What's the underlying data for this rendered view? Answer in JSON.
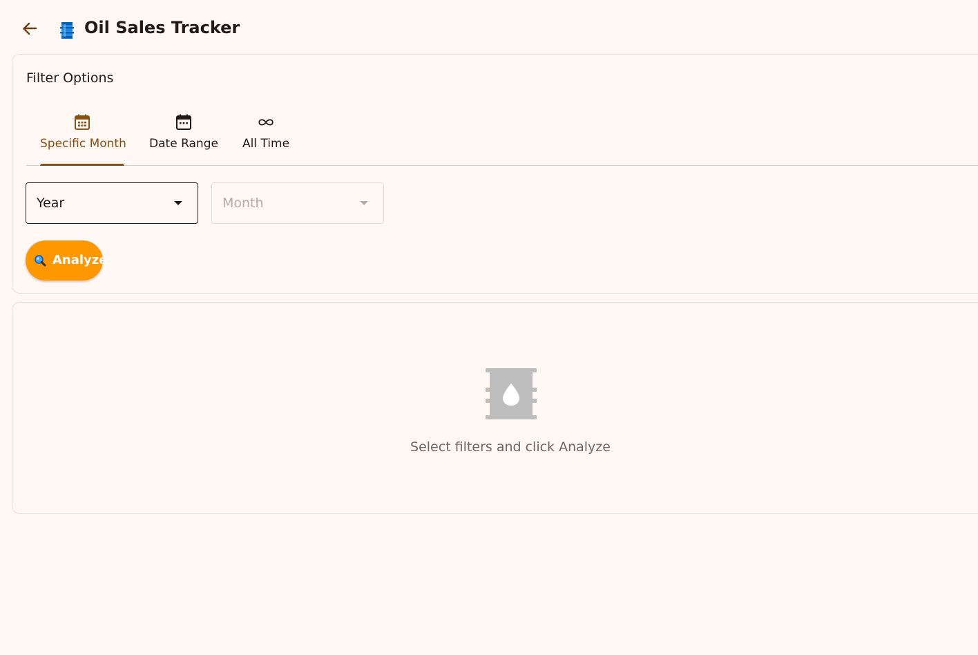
{
  "app_bar": {
    "title": "Oil Sales Tracker",
    "back_icon": "arrow-back-icon",
    "title_icon": "oil-drum-icon"
  },
  "filter": {
    "title": "Filter Options",
    "tabs": [
      {
        "label": "Specific Month",
        "icon": "calendar-month-icon",
        "active": true
      },
      {
        "label": "Date Range",
        "icon": "calendar-icon",
        "active": false
      },
      {
        "label": "All Time",
        "icon": "infinity-icon",
        "active": false
      }
    ],
    "year_select": {
      "value": "Year",
      "enabled": true
    },
    "month_select": {
      "value": "Month",
      "enabled": false
    },
    "analyze_button": {
      "label": "Analyze",
      "icon": "magnifier-icon"
    }
  },
  "results": {
    "empty_icon": "oil-barrel-icon",
    "empty_message": "Select filters and click Analyze"
  },
  "colors": {
    "background": "#fff8f5",
    "accent": "#8a4f12",
    "button": "#ff9800",
    "text": "#201a17",
    "muted": "#6f6460",
    "empty_icon": "#bdbdbd"
  }
}
